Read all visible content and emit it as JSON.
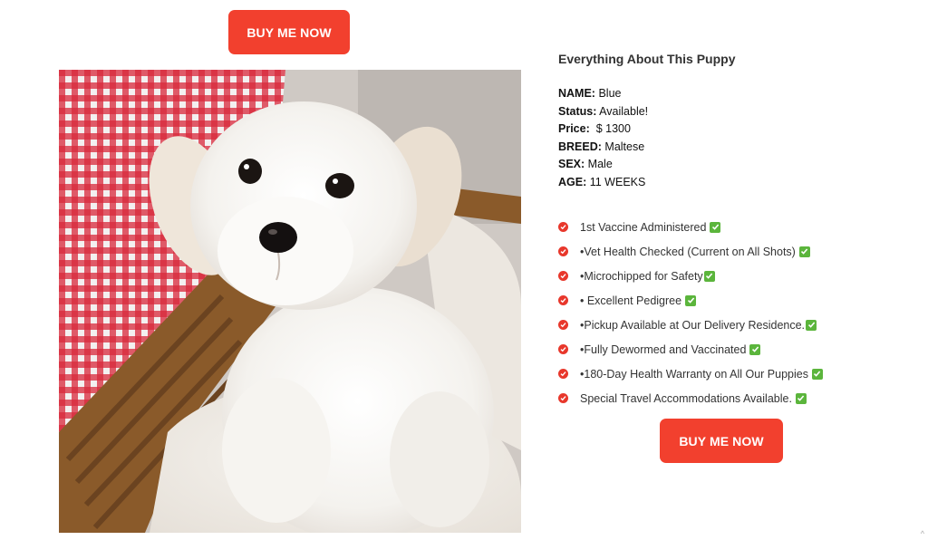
{
  "buttons": {
    "top_label": "BUY ME NOW",
    "bottom_label": "BUY ME NOW"
  },
  "photo": {
    "icon": "puppy-photo"
  },
  "details": {
    "heading": "Everything About This Puppy",
    "name_label": "NAME:",
    "name_value": "Blue",
    "status_label": "Status:",
    "status_value": "Available!",
    "price_label": "Price:",
    "price_value": "$ 1300",
    "breed_label": "BREED:",
    "breed_value": "Maltese",
    "sex_label": "SEX:",
    "sex_value": "Male",
    "age_label": "AGE:",
    "age_value": "11 WEEKS"
  },
  "features": [
    "1st Vaccine Administered",
    "•Vet Health Checked (Current on All Shots)",
    "•Microchipped for Safety",
    "• Excellent Pedigree",
    "•Pickup Available at Our Delivery Residence.",
    "•Fully Dewormed and Vaccinated",
    "•180-Day Health Warranty on All Our Puppies",
    "Special Travel Accommodations Available."
  ],
  "colors": {
    "accent": "#f2402e",
    "bullet": "#e8372b",
    "check": "#5bb53c"
  },
  "scroll_indicator": "^"
}
